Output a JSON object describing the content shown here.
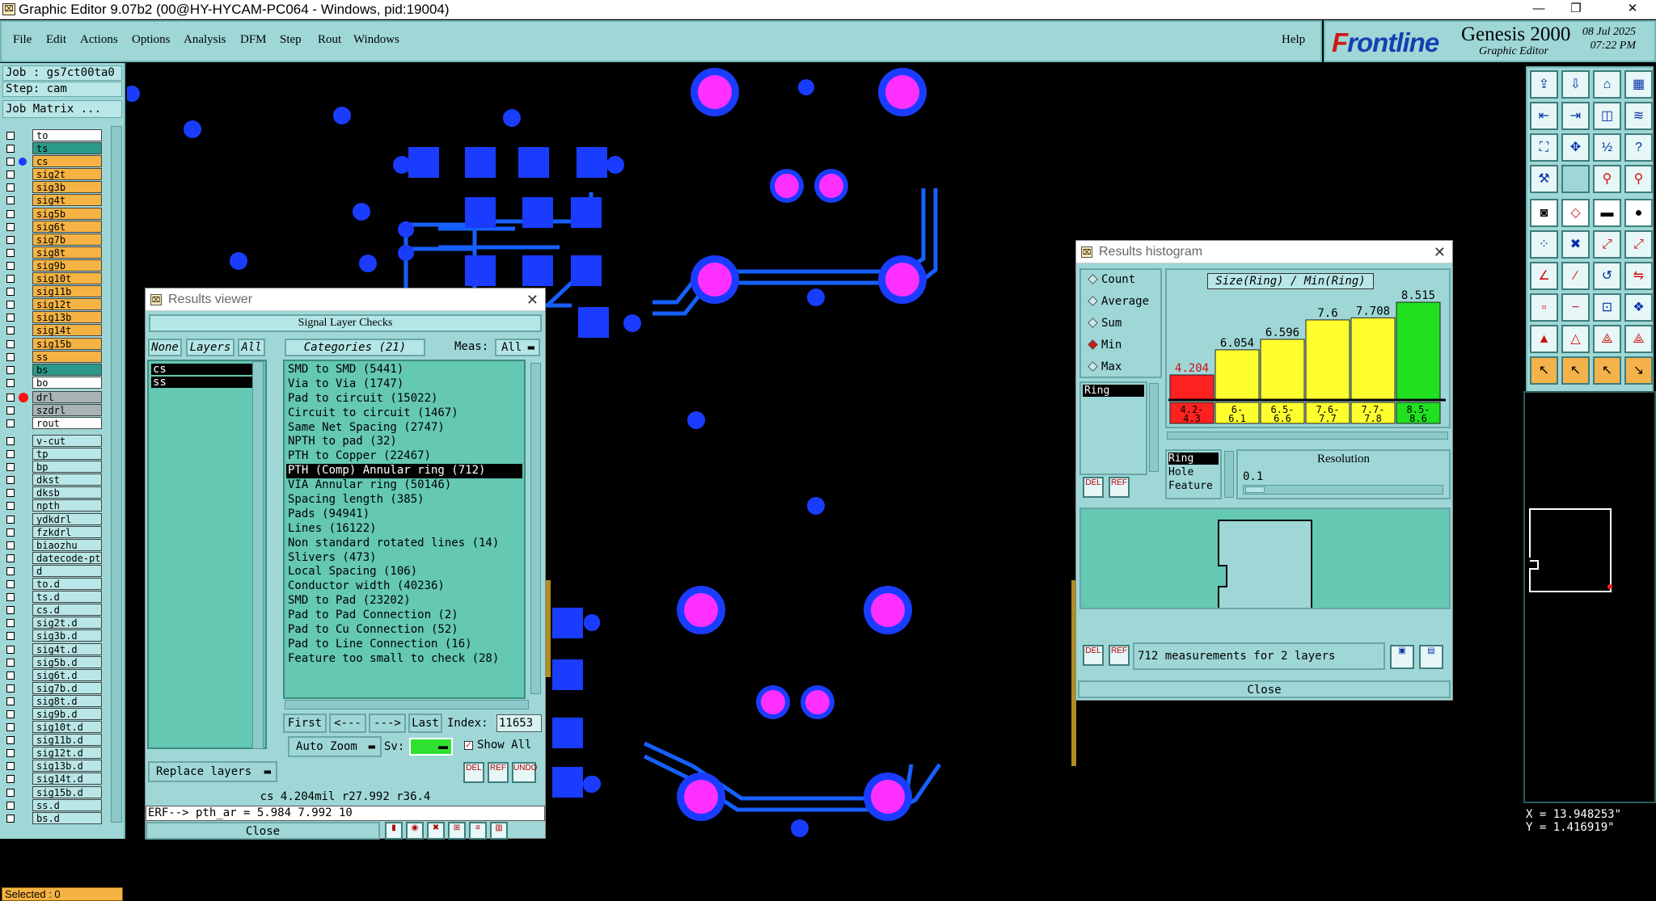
{
  "window": {
    "title": "Graphic Editor 9.07b2 (00@HY-HYCAM-PC064 - Windows, pid:19004)"
  },
  "menu": {
    "items": [
      "File",
      "Edit",
      "Actions",
      "Options",
      "Analysis",
      "DFM",
      "Step",
      "Rout",
      "Windows"
    ],
    "help": "Help"
  },
  "brand": {
    "logo_f": "F",
    "logo_rest": "rontline",
    "product": "Genesis 2000",
    "sub": "Graphic Editor",
    "date": "08 Jul 2025",
    "time": "07:22 PM"
  },
  "job": {
    "job": "Job : gs7ct00ta0",
    "step": "Step: cam",
    "matrix": "Job Matrix ..."
  },
  "layers_a": [
    "to",
    "ts",
    "cs",
    "sig2t",
    "sig3b",
    "sig4t",
    "sig5b",
    "sig6t",
    "sig7b",
    "sig8t",
    "sig9b",
    "sig10t",
    "sig11b",
    "sig12t",
    "sig13b",
    "sig14t",
    "sig15b",
    "ss",
    "bs",
    "bo"
  ],
  "layers_b": [
    "drl",
    "szdrl",
    "rout"
  ],
  "layers_c": [
    "v-cut",
    "tp",
    "bp",
    "dkst",
    "dksb",
    "npth",
    "ydkdrl",
    "fzkdrl",
    "biaozhu",
    "datecode-pt",
    "d",
    "to.d",
    "ts.d",
    "cs.d",
    "sig2t.d",
    "sig3b.d",
    "sig4t.d",
    "sig5b.d",
    "sig6t.d",
    "sig7b.d",
    "sig8t.d",
    "sig9b.d",
    "sig10t.d",
    "sig11b.d",
    "sig12t.d",
    "sig13b.d",
    "sig14t.d",
    "sig15b.d",
    "ss.d",
    "bs.d"
  ],
  "selected": "Selected : 0",
  "coords": {
    "x": "X = 13.948253\"",
    "y": "Y = 1.416919\""
  },
  "results_viewer": {
    "title": "Results viewer",
    "header": "Signal Layer Checks",
    "none": "None",
    "layers": "Layers",
    "all": "All",
    "categories_label": "Categories (21)",
    "meas_label": "Meas:",
    "meas_value": "All",
    "layer_items": [
      "cs",
      "ss"
    ],
    "categories": [
      "SMD to SMD (5441)",
      "Via to Via (1747)",
      "Pad to circuit (15022)",
      "Circuit to circuit (1467)",
      "Same Net Spacing (2747)",
      "NPTH to pad (32)",
      "PTH to Copper (22467)",
      "PTH (Comp) Annular ring (712)",
      "VIA Annular ring (50146)",
      "Spacing length (385)",
      "Pads (94941)",
      "Lines (16122)",
      "Non standard rotated lines (14)",
      "Slivers (473)",
      "Local Spacing (106)",
      "Conductor width (40236)",
      "SMD to Pad (23202)",
      "Pad to Pad Connection (2)",
      "Pad to Cu Connection (52)",
      "Pad to Line Connection (16)",
      "Feature too small to check (28)"
    ],
    "selected_index": 7,
    "first": "First",
    "prev": "<---",
    "next": "--->",
    "last": "Last",
    "index_label": "Index:",
    "index_value": "11653",
    "auto_zoom": "Auto Zoom",
    "sv": "Sv:",
    "show_all": "Show All",
    "replace_layers": "Replace layers",
    "status": "cs 4.204mil  r27.992  r36.4",
    "erf": "ERF--> pth_ar = 5.984 7.992 10",
    "close": "Close",
    "btn_del": "DEL",
    "btn_ref": "REF",
    "btn_undo": "UNDO"
  },
  "histogram": {
    "title": "Results histogram",
    "chart_title": "Size(Ring) / Min(Ring)",
    "modes": [
      "Count",
      "Average",
      "Sum",
      "Min",
      "Max"
    ],
    "active_mode": "Min",
    "field": "Ring",
    "resolution_label": "Resolution",
    "resolution_value": "0.1",
    "ring_options": [
      "Ring",
      "Hole",
      "Feature"
    ],
    "summary": "712 measurements for 2 layers",
    "close": "Close",
    "btn_del": "DEL",
    "btn_ref": "REF"
  },
  "chart_data": {
    "type": "bar",
    "title": "Size(Ring) / Min(Ring)",
    "categories": [
      "4.2-4.3",
      "6-6.1",
      "6.5-6.6",
      "7.6-7.7",
      "7.7-7.8",
      "8.5-8.6"
    ],
    "values": [
      4.204,
      6.054,
      6.596,
      7.6,
      7.708,
      8.515
    ],
    "value_labels": [
      "4.204",
      "6.054",
      "6.596",
      "7.6",
      "7.708",
      "8.515"
    ],
    "colors": [
      "#ff2020",
      "#ffff30",
      "#ffff30",
      "#ffff30",
      "#ffff30",
      "#20e020"
    ],
    "ylim": [
      0,
      8.515
    ]
  }
}
